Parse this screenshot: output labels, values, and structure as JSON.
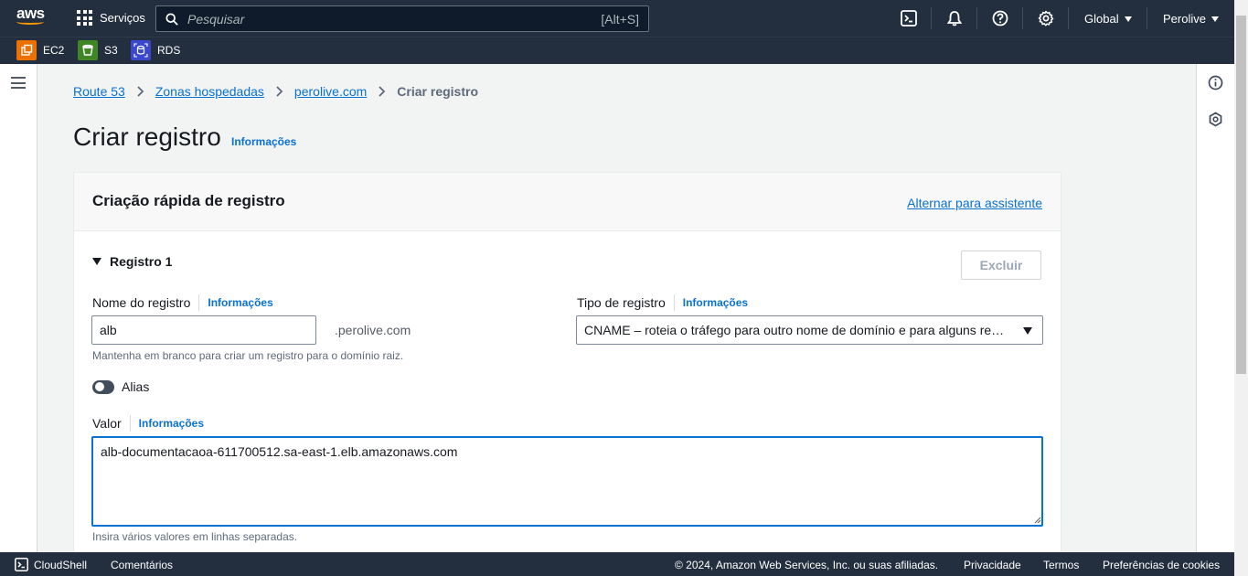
{
  "topnav": {
    "logo": "aws",
    "services_label": "Serviços",
    "search_placeholder": "Pesquisar",
    "search_shortcut": "[Alt+S]",
    "region_label": "Global",
    "account_label": "Perolive",
    "icons": [
      "cloudshell-icon",
      "bell-icon",
      "help-icon",
      "gear-icon"
    ]
  },
  "favorites": [
    {
      "label": "EC2",
      "color": "#ed7100"
    },
    {
      "label": "S3",
      "color": "#3f8624"
    },
    {
      "label": "RDS",
      "color": "#3b48cc"
    }
  ],
  "breadcrumb": {
    "items": [
      "Route 53",
      "Zonas hospedadas",
      "perolive.com"
    ],
    "current": "Criar registro"
  },
  "page": {
    "title": "Criar registro",
    "info": "Informações"
  },
  "container": {
    "title": "Criação rápida de registro",
    "wizard_link": "Alternar para assistente"
  },
  "record": {
    "section_label": "Registro 1",
    "delete_label": "Excluir",
    "name_label": "Nome do registro",
    "name_info": "Informações",
    "name_value": "alb",
    "domain_suffix": ".perolive.com",
    "name_hint": "Mantenha em branco para criar um registro para o domínio raiz.",
    "type_label": "Tipo de registro",
    "type_info": "Informações",
    "type_value": "CNAME – roteia o tráfego para outro nome de domínio e para alguns recursos da AWS",
    "alias_label": "Alias",
    "alias_enabled": false,
    "value_label": "Valor",
    "value_info": "Informações",
    "value_text": "alb-documentacaoa-611700512.sa-east-1.elb.amazonaws.com",
    "value_hint": "Insira vários valores em linhas separadas."
  },
  "footer": {
    "cloudshell": "CloudShell",
    "feedback": "Comentários",
    "copyright": "© 2024, Amazon Web Services, Inc. ou suas afiliadas.",
    "privacy": "Privacidade",
    "terms": "Termos",
    "cookies": "Preferências de cookies"
  },
  "colors": {
    "nav_bg": "#232f3e",
    "link": "#0972d3",
    "accent": "#ff9900"
  }
}
